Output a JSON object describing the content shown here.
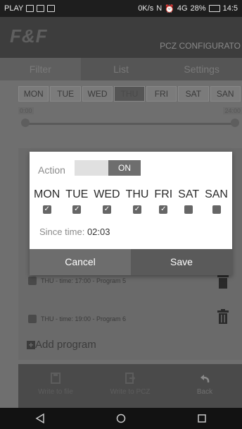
{
  "status_bar": {
    "carrier": "PLAY",
    "speed": "0K/s",
    "signal": "4G",
    "battery": "28%",
    "time": "14:5"
  },
  "header": {
    "logo": "F&F",
    "title": "PCZ CONFIGURATO"
  },
  "tabs": [
    {
      "label": "Filter"
    },
    {
      "label": "List"
    },
    {
      "label": "Settings"
    }
  ],
  "days": [
    "MON",
    "TUE",
    "WED",
    "THU",
    "FRI",
    "SAT",
    "SAN"
  ],
  "slider": {
    "min_label": "0:00",
    "max_label": "24:00"
  },
  "list": {
    "items": [
      {
        "text": "THU - time: 17:00 - Program 5"
      },
      {
        "text": "THU - time: 19:00 - Program 6"
      }
    ],
    "add_label": "Add program"
  },
  "bottom_bar": [
    {
      "label": "Write to file"
    },
    {
      "label": "Write to PCZ"
    },
    {
      "label": "Back"
    }
  ],
  "dialog": {
    "action_label": "Action",
    "toggle_state": "ON",
    "days": [
      {
        "name": "MON",
        "checked": true
      },
      {
        "name": "TUE",
        "checked": true
      },
      {
        "name": "WED",
        "checked": true
      },
      {
        "name": "THU",
        "checked": true
      },
      {
        "name": "FRI",
        "checked": true
      },
      {
        "name": "SAT",
        "checked": false
      },
      {
        "name": "SAN",
        "checked": false
      }
    ],
    "since_label": "Since time:",
    "since_value": "02:03",
    "cancel_label": "Cancel",
    "save_label": "Save"
  },
  "navbar": {
    "back_icon": "triangle-back-icon",
    "home_icon": "circle-home-icon",
    "recent_icon": "square-recent-icon"
  }
}
